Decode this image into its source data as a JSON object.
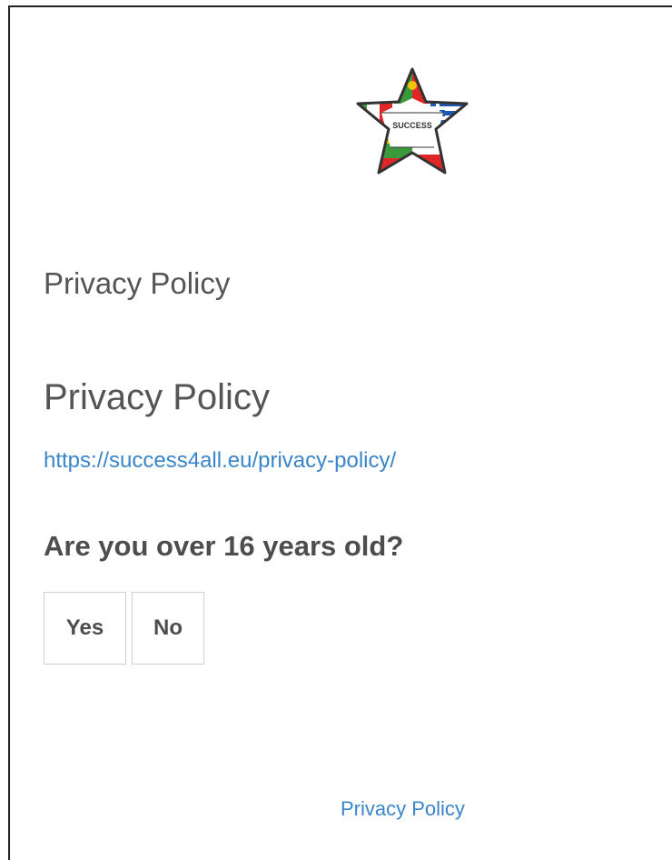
{
  "logo": {
    "text": "SUCCESS",
    "icon": "star-flags-logo",
    "colors": {
      "green": "#3a9a3a",
      "red": "#e02727",
      "white": "#ffffff",
      "yellow": "#f2c40a",
      "blue": "#1f57b5",
      "outline": "#333333"
    }
  },
  "header": {
    "section_label": "Privacy Policy"
  },
  "main": {
    "heading": "Privacy Policy",
    "policy_link": "https://success4all.eu/privacy-policy/",
    "question": "Are you over 16 years old?",
    "buttons": {
      "yes_label": "Yes",
      "no_label": "No"
    }
  },
  "footer": {
    "link_label": "Privacy Policy"
  },
  "colors": {
    "text": "#555555",
    "link": "#3a85c9",
    "button_border": "#cfcfcf"
  }
}
